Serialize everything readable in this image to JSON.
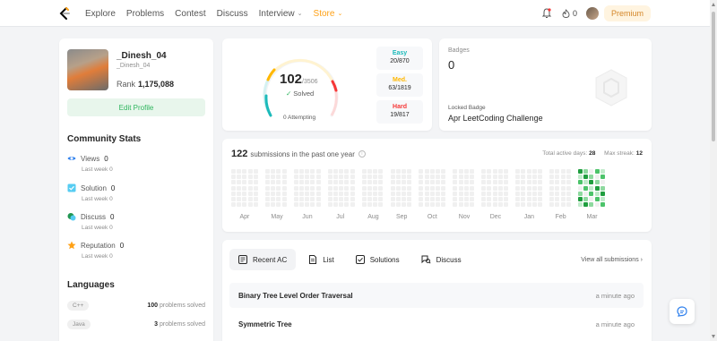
{
  "nav": {
    "links": [
      "Explore",
      "Problems",
      "Contest",
      "Discuss",
      "Interview",
      "Store"
    ],
    "streak_count": "0",
    "premium_label": "Premium"
  },
  "profile": {
    "username": "_Dinesh_04",
    "handle": "_Dinesh_04",
    "rank_label": "Rank",
    "rank_value": "1,175,088",
    "edit_label": "Edit Profile",
    "community_title": "Community Stats",
    "stats": [
      {
        "label": "Views",
        "value": "0",
        "sub": "Last week",
        "sub_value": "0",
        "icon": "eye-icon"
      },
      {
        "label": "Solution",
        "value": "0",
        "sub": "Last week",
        "sub_value": "0",
        "icon": "solution-icon"
      },
      {
        "label": "Discuss",
        "value": "0",
        "sub": "Last week",
        "sub_value": "0",
        "icon": "discuss-icon"
      },
      {
        "label": "Reputation",
        "value": "0",
        "sub": "Last week",
        "sub_value": "0",
        "icon": "star-icon"
      }
    ],
    "languages_title": "Languages",
    "languages": [
      {
        "name": "C++",
        "count": "100",
        "suffix": "problems solved"
      },
      {
        "name": "Java",
        "count": "3",
        "suffix": "problems solved"
      }
    ]
  },
  "progress": {
    "solved": "102",
    "total": "/3506",
    "solved_label": "Solved",
    "attempting": "0 Attempting",
    "difficulties": [
      {
        "name": "Easy",
        "count": "20/870",
        "color": "#1cbaba"
      },
      {
        "name": "Med.",
        "count": "63/1819",
        "color": "#ffb700"
      },
      {
        "name": "Hard",
        "count": "19/817",
        "color": "#f63737"
      }
    ]
  },
  "badges": {
    "title": "Badges",
    "count": "0",
    "locked_label": "Locked Badge",
    "locked_name": "Apr LeetCoding Challenge"
  },
  "heatmap": {
    "count": "122",
    "title_suffix": "submissions in the past one year",
    "active_label": "Total active days:",
    "active_value": "28",
    "streak_label": "Max streak:",
    "streak_value": "12",
    "months": [
      "Apr",
      "May",
      "Jun",
      "Jul",
      "Aug",
      "Sep",
      "Oct",
      "Nov",
      "Dec",
      "Jan",
      "Feb",
      "Mar"
    ]
  },
  "recent": {
    "tabs": [
      {
        "label": "Recent AC",
        "icon": "recent-ac-icon"
      },
      {
        "label": "List",
        "icon": "list-icon"
      },
      {
        "label": "Solutions",
        "icon": "solutions-icon"
      },
      {
        "label": "Discuss",
        "icon": "discuss-icon"
      }
    ],
    "view_all": "View all submissions",
    "rows": [
      {
        "title": "Binary Tree Level Order Traversal",
        "time": "a minute ago"
      },
      {
        "title": "Symmetric Tree",
        "time": "a minute ago"
      }
    ]
  }
}
